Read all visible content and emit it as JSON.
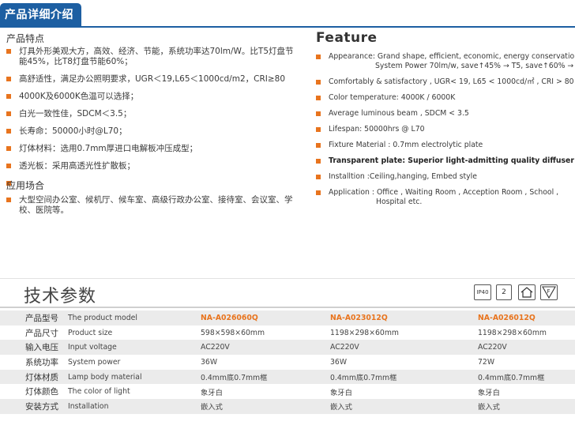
{
  "header": {
    "title": "产品详细介绍"
  },
  "cn": {
    "features_title": "产品特点",
    "features": [
      {
        "text": "灯具外形美观大方，高效、经济、节能，系统功率达70lm/W。比T5灯盘节能45%，比T8灯盘节能60%；"
      },
      {
        "text": "高舒适性，满足办公照明要求，UGR＜19,L65＜1000cd/m2，CRI≥80"
      },
      {
        "text": "4000K及6000K色温可以选择；"
      },
      {
        "text": "白光一致性佳，SDCM＜3.5；"
      },
      {
        "text": "长寿命：50000小时@L70；"
      },
      {
        "text": "灯体材料：选用0.7mm厚进口电解板冲压成型；"
      },
      {
        "text": "透光板：采用高透光性扩散板；"
      },
      {
        "text": ""
      }
    ],
    "apps_title": "应用场合",
    "apps": [
      {
        "text": "大型空间办公室、候机厅、候车室、高级行政办公室、接待室、会议室、学校、医院等。"
      }
    ]
  },
  "en": {
    "title": "Feature",
    "items": [
      {
        "text": "Appearance: Grand shape, efficient, economic, energy  conservation,",
        "cont": "System Power 70lm/w, save↑45% → T5, save↑60% → T8"
      },
      {
        "text": "Comfortably & satisfactory , UGR< 19, L65 < 1000cd/㎡ , CRI > 80"
      },
      {
        "text": "Color temperature: 4000K / 6000K"
      },
      {
        "text": "Average luminous beam , SDCM < 3.5"
      },
      {
        "text": "Lifespan: 50000hrs @ L70"
      },
      {
        "text": "Fixture Material : 0.7mm electrolytic plate"
      },
      {
        "text": "Transparent plate: Superior light-admitting quality diffuser"
      },
      {
        "text": "Installtion :Ceiling,hanging, Embed  style"
      },
      {
        "text": "Application : Office  , Waiting Room , Acception Room , School ,",
        "cont": "Hospital etc."
      }
    ]
  },
  "tech": {
    "title": "技术参数",
    "icons": {
      "ip": "IP40",
      "class": "2",
      "ceiling": "ceiling-mount-icon",
      "f_mark": "F"
    },
    "rows": [
      {
        "cn": "产品型号",
        "en": "The product model",
        "v1": "NA-A026060Q",
        "v2": "NA-A023012Q",
        "v3": "NA-A026012Q"
      },
      {
        "cn": "产品尺寸",
        "en": "Product size",
        "v1": "598×598×60mm",
        "v2": "1198×298×60mm",
        "v3": "1198×298×60mm"
      },
      {
        "cn": "输入电压",
        "en": "Input voltage",
        "v1": "AC220V",
        "v2": "AC220V",
        "v3": "AC220V"
      },
      {
        "cn": "系统功率",
        "en": "System power",
        "v1": "36W",
        "v2": "36W",
        "v3": "72W"
      },
      {
        "cn": "灯体材质",
        "en": "Lamp body material",
        "v1": "0.4mm底0.7mm框",
        "v2": "0.4mm底0.7mm框",
        "v3": "0.4mm底0.7mm框"
      },
      {
        "cn": "灯体颜色",
        "en": "The color of light",
        "v1": "象牙白",
        "v2": "象牙白",
        "v3": "象牙白"
      },
      {
        "cn": "安装方式",
        "en": "Installation",
        "v1": "嵌入式",
        "v2": "嵌入式",
        "v3": "嵌入式"
      }
    ]
  },
  "colors": {
    "brand_blue": "#1d5fa2",
    "bullet_orange": "#e8741e",
    "row_gray": "#ebebeb"
  }
}
